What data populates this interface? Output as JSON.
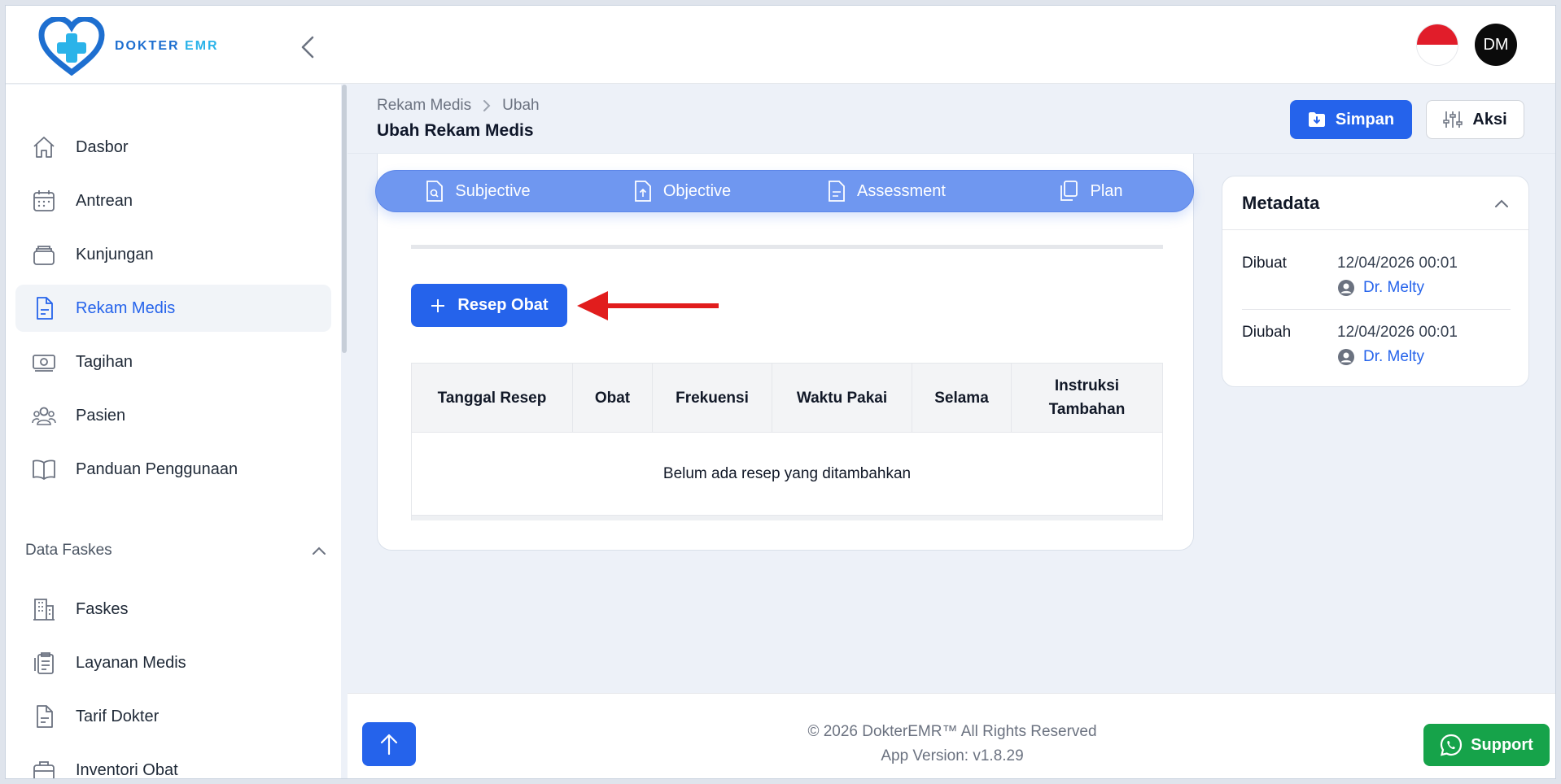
{
  "app": {
    "logo_text_main": "DOKTER",
    "logo_text_accent": "EMR"
  },
  "header": {
    "avatar_initials": "DM",
    "flag": "Indonesia"
  },
  "sidebar": {
    "items": [
      {
        "label": "Dasbor",
        "icon": "home-icon"
      },
      {
        "label": "Antrean",
        "icon": "calendar-icon"
      },
      {
        "label": "Kunjungan",
        "icon": "inbox-icon"
      },
      {
        "label": "Rekam Medis",
        "icon": "document-icon",
        "active": true
      },
      {
        "label": "Tagihan",
        "icon": "money-icon"
      },
      {
        "label": "Pasien",
        "icon": "users-icon"
      },
      {
        "label": "Panduan Penggunaan",
        "icon": "book-icon"
      }
    ],
    "section_label": "Data Faskes",
    "section_items": [
      {
        "label": "Faskes",
        "icon": "building-icon"
      },
      {
        "label": "Layanan Medis",
        "icon": "clipboard-icon"
      },
      {
        "label": "Tarif Dokter",
        "icon": "file-icon"
      },
      {
        "label": "Inventori Obat",
        "icon": "briefcase-icon"
      }
    ]
  },
  "page": {
    "breadcrumb": [
      "Rekam Medis",
      "Ubah"
    ],
    "title": "Ubah Rekam Medis",
    "save_label": "Simpan",
    "action_label": "Aksi"
  },
  "soap_tabs": [
    "Subjective",
    "Objective",
    "Assessment",
    "Plan"
  ],
  "prescription": {
    "add_button": "Resep Obat",
    "columns": [
      "Tanggal Resep",
      "Obat",
      "Frekuensi",
      "Waktu Pakai",
      "Selama",
      "Instruksi Tambahan"
    ],
    "empty_text": "Belum ada resep yang ditambahkan"
  },
  "metadata": {
    "title": "Metadata",
    "created_label": "Dibuat",
    "created_date": "12/04/2026 00:01",
    "created_by": "Dr. Melty",
    "updated_label": "Diubah",
    "updated_date": "12/04/2026 00:01",
    "updated_by": "Dr. Melty"
  },
  "footer": {
    "copyright": "© 2026 DokterEMR™ All Rights Reserved",
    "version": "App Version: v1.8.29",
    "support_label": "Support"
  },
  "colors": {
    "primary": "#2563eb",
    "soap_bar": "#6f97f0",
    "support": "#16a34a",
    "annotation_arrow": "#e11d1d"
  }
}
